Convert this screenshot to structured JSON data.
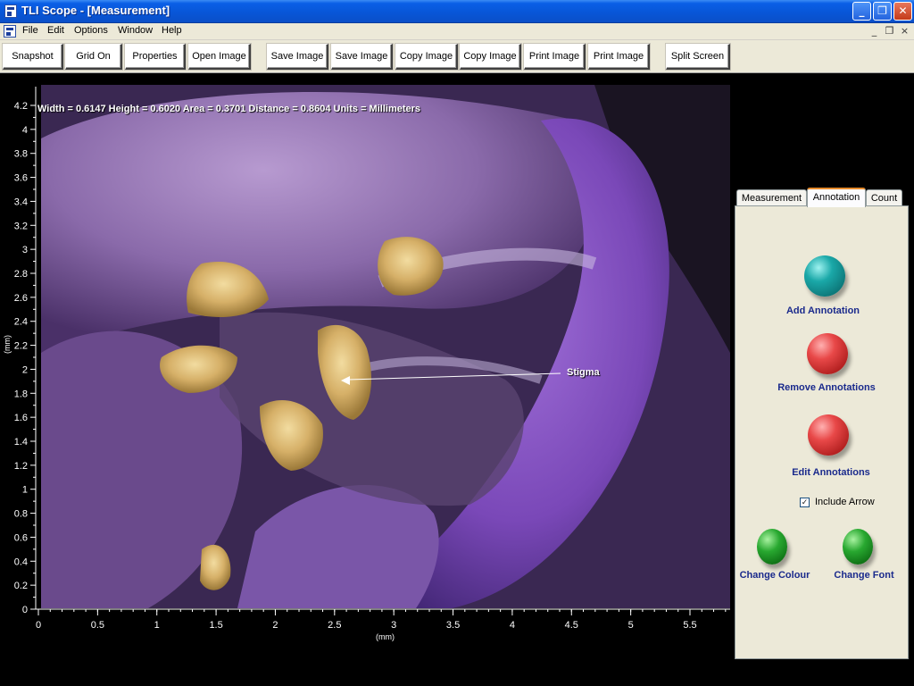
{
  "window": {
    "title": "TLI Scope - [Measurement]",
    "minimize_icon": "minimize-icon",
    "restore_icon": "restore-icon",
    "close_icon": "close-icon"
  },
  "menu": {
    "items": [
      "File",
      "Edit",
      "Options",
      "Window",
      "Help"
    ],
    "mdi_minimize": "_",
    "mdi_restore": "❐",
    "mdi_close": "×"
  },
  "toolbar": {
    "buttons": [
      "Snapshot",
      "Grid On",
      "Properties",
      "Open Image",
      "Save Image",
      "Save Image",
      "Copy Image",
      "Copy Image",
      "Print Image",
      "Print Image",
      "Split Screen"
    ]
  },
  "measurement": {
    "readout": "Width = 0.6147   Height = 0.6020   Area = 0.3701   Distance = 0.8604   Units = Millimeters",
    "x_unit": "(mm)",
    "y_unit": "(mm)",
    "x_ticks": [
      "0",
      "0.5",
      "1",
      "1.5",
      "2",
      "2.5",
      "3",
      "3.5",
      "4",
      "4.5",
      "5",
      "5.5"
    ],
    "y_ticks": [
      "0",
      "0.2",
      "0.4",
      "0.6",
      "0.8",
      "1",
      "1.2",
      "1.4",
      "1.6",
      "1.8",
      "2",
      "2.2",
      "2.4",
      "2.6",
      "2.8",
      "3",
      "3.2",
      "3.4",
      "3.6",
      "3.8",
      "4",
      "4.2"
    ]
  },
  "annotation_overlay": {
    "label": "Stigma"
  },
  "panel": {
    "tabs": [
      "Measurement",
      "Annotation",
      "Count"
    ],
    "active_tab": "Annotation",
    "add_annotation": "Add Annotation",
    "remove_annotations": "Remove Annotations",
    "edit_annotations": "Edit Annotations",
    "include_arrow": "Include Arrow",
    "include_arrow_checked": true,
    "change_colour": "Change Colour",
    "change_font": "Change Font",
    "colors": {
      "teal": "#1aa8a8",
      "red": "#e84848",
      "green": "#28a830",
      "label": "#1a2a8c"
    }
  }
}
